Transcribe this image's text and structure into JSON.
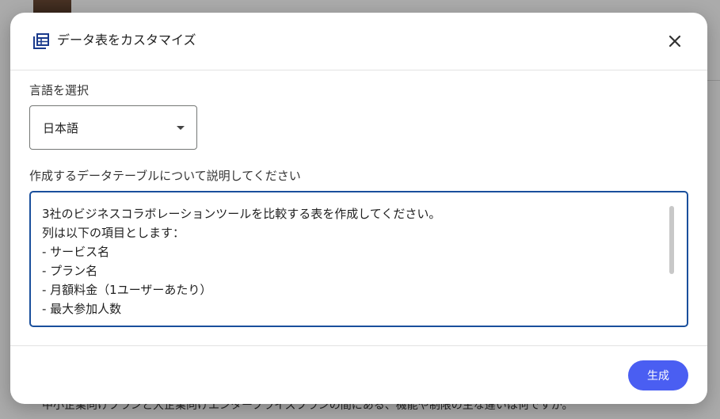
{
  "background": {
    "partial_text": "中小企業向けプランと大企業向けエンタープライズプランの間にある、機能や制限の主な違いは何ですか。"
  },
  "dialog": {
    "title": "データ表をカスタマイズ",
    "icon": "table-icon",
    "close_icon": "close-icon",
    "language_label": "言語を選択",
    "language_value": "日本語",
    "description_label": "作成するデータテーブルについて説明してください",
    "prompt_lines": [
      "3社のビジネスコラボレーションツールを比較する表を作成してください。",
      "列は以下の項目とします：",
      "- サービス名",
      "- プラン名",
      "- 月額料金（1ユーザーあたり）",
      "- 最大参加人数"
    ],
    "generate_label": "生成"
  },
  "colors": {
    "accent": "#4a5ef2",
    "focus_border": "#1a4f9c",
    "icon": "#1a3a8c"
  }
}
